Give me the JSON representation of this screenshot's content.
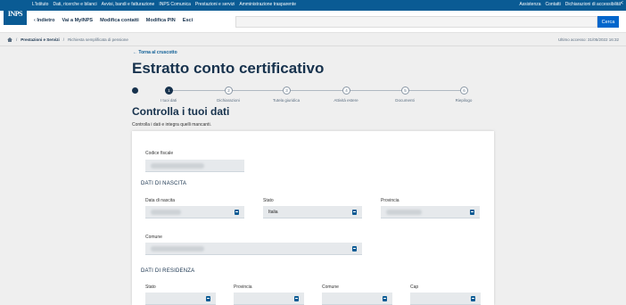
{
  "topbar": {
    "logo": "INPS",
    "links": [
      "L'Istituto",
      "Dati, ricerche e bilanci",
      "Avvisi, bandi e fatturazione",
      "INPS Comunica",
      "Prestazioni e servizi",
      "Amministrazione trasparente"
    ],
    "right": [
      "Assistenza",
      "Contatti",
      "Dichiarazioni di accessibilità"
    ]
  },
  "navbar": {
    "links": [
      "‹ Indietro",
      "Vai a MyINPS",
      "Modifica contatti",
      "Modifica PIN",
      "Esci"
    ],
    "search_button": "Cerca",
    "search_placeholder": ""
  },
  "breadcrumb": {
    "home_icon": "home-icon",
    "items": [
      "Prestazioni e Servizi",
      "Richiesta semplificata di pensione"
    ],
    "last_access": "Ultimo accesso: 31/05/2022 16:32"
  },
  "page": {
    "back": "← Torna al cruscotto",
    "title": "Estratto conto certificativo",
    "section_title": "Controlla i tuoi dati",
    "hint": "Controlla i dati e integra quelli mancanti."
  },
  "stepper": {
    "steps": [
      {
        "num": "1",
        "label": "I tuoi dati",
        "active": true
      },
      {
        "num": "2",
        "label": "Dichiarazioni",
        "active": false
      },
      {
        "num": "3",
        "label": "Tutela giuridica",
        "active": false
      },
      {
        "num": "4",
        "label": "Attività estere",
        "active": false
      },
      {
        "num": "5",
        "label": "Documenti",
        "active": false
      },
      {
        "num": "6",
        "label": "Riepilogo",
        "active": false
      }
    ]
  },
  "form": {
    "codice_fiscale_label": "Codice fiscale",
    "nascita_section": "DATI DI NASCITA",
    "data_nascita_label": "Data di nascita",
    "stato_label": "Stato",
    "stato_value": "Italia",
    "provincia_label": "Provincia",
    "comune_label": "Comune",
    "residenza_section": "DATI DI RESIDENZA",
    "res_stato_label": "Stato",
    "res_provincia_label": "Provincia",
    "res_comune_label": "Comune",
    "res_cap_label": "Cap"
  }
}
